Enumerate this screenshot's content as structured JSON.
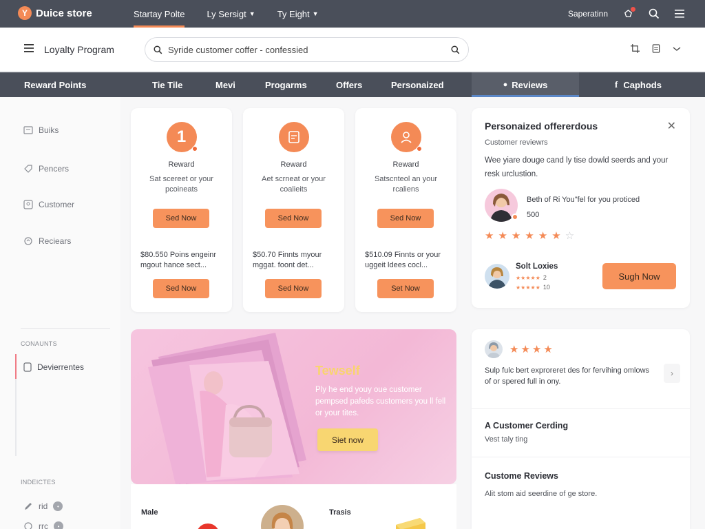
{
  "colors": {
    "accent": "#f48a56",
    "topbar": "#4a4f5a",
    "banner": "#f6c5df",
    "tab_highlight": "#5b87c7"
  },
  "app": {
    "brand_initial": "Y",
    "brand_name": "Duice store"
  },
  "topnav": {
    "items": [
      {
        "label": "Startay Polte",
        "has_menu": false,
        "active": true
      },
      {
        "label": "Ly Sersigt",
        "has_menu": true,
        "active": false
      },
      {
        "label": "Ty Eight",
        "has_menu": true,
        "active": false
      }
    ],
    "right_label": "Saperatinn",
    "icons": [
      "bell-icon",
      "search-icon",
      "menu-icon"
    ]
  },
  "header": {
    "title": "Loyalty Program",
    "search_value": "Syride customer coffer - confessied",
    "icons": [
      "crop-icon",
      "document-icon",
      "more-icon"
    ]
  },
  "tabs": [
    {
      "label": "Reward Points"
    },
    {
      "label": "Tie Tile"
    },
    {
      "label": "Mevi"
    },
    {
      "label": "Progarms"
    },
    {
      "label": "Offers"
    },
    {
      "label": "Personaized"
    },
    {
      "label": "Reviews",
      "active": true
    },
    {
      "label": "Caphods"
    }
  ],
  "sidebar": {
    "items": [
      {
        "label": "Buiks",
        "icon": "box-icon"
      },
      {
        "label": "Pencers",
        "icon": "tag-icon"
      },
      {
        "label": "Customer",
        "icon": "user-badge-icon"
      },
      {
        "label": "Reciears",
        "icon": "refresh-icon"
      }
    ],
    "section1": "CONAUNTS",
    "section1_item": "Devierrentes",
    "section2": "INDEICTES",
    "section2_items": [
      {
        "label": "rid",
        "badge": "•"
      },
      {
        "label": "rrc",
        "badge": "•"
      }
    ]
  },
  "rewards": [
    {
      "icon_text": "1",
      "icon": "number-one-icon",
      "label": "Reward",
      "desc": "Sat scereet or your pcoineats",
      "btn1": "Sed Now",
      "offer": "$80.550 Poins engeinr mgout hance sect...",
      "btn2": "Sed Now"
    },
    {
      "icon_text": "",
      "icon": "gift-card-icon",
      "label": "Reward",
      "desc": "Aet scrneat or your coalieits",
      "btn1": "Sed Now",
      "offer": "$50.70 Finnts myour mggat. foont det...",
      "btn2": "Sed Now"
    },
    {
      "icon_text": "",
      "icon": "user-icon",
      "label": "Reward",
      "desc": "Satscnteol an your rcaliens",
      "btn1": "Sed Now",
      "offer": "$510.09 Finnts or your uggeit ldees cocl...",
      "btn2": "Set Now"
    }
  ],
  "personalized": {
    "title": "Personaized offererdous",
    "subtitle": "Customer reviewrs",
    "text": "Wee yiare douge cand ly tise dowld seerds and your resk urclustion.",
    "quote": "Beth of Ri You\"fel for you proticed",
    "quote_value": "500",
    "rating": 6,
    "rating_max": 7,
    "reviewer": {
      "name": "Solt Loxies",
      "line1_count": "2",
      "line2_count": "10"
    },
    "button": "Sugh Now"
  },
  "banner": {
    "headline": "Tewself",
    "text": "Ply he end youy oue customer pempsed pafeds customers you ll fell or your tites.",
    "button": "Siet now"
  },
  "products": [
    {
      "label": "Male"
    },
    {
      "label": "Trasis"
    }
  ],
  "reviews": {
    "stars": 4,
    "text": "Sulp fulc bert exproreret des for fervihing omlows of or spered full in ony.",
    "heading1": "A Customer Cerding",
    "sub1": "Vest taly ting",
    "heading2": "Custome Reviews",
    "sub2": "Alit stom aid seerdine of ge store."
  }
}
